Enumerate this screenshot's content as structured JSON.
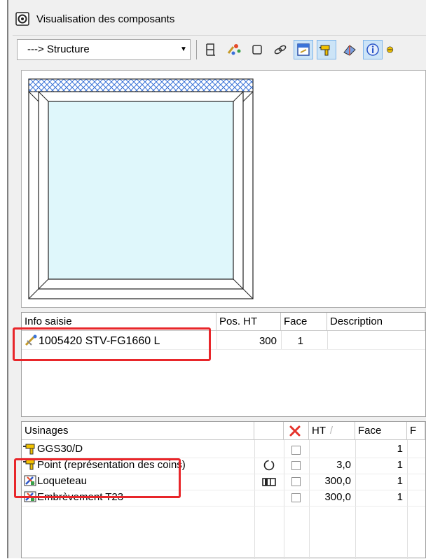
{
  "window": {
    "title": "Visualisation des composants"
  },
  "toolbar": {
    "view_select": "---> Structure"
  },
  "info_grid": {
    "columns": [
      "Info saisie",
      "Pos. HT",
      "Face",
      "Description"
    ],
    "rows": [
      {
        "info": "1005420 STV-FG1660 L",
        "pos_ht": "300",
        "face": "1",
        "description": ""
      }
    ]
  },
  "usinages_grid": {
    "columns": [
      "Usinages",
      "HT",
      "Face",
      "F"
    ],
    "sort_indicator": "/",
    "rows": [
      {
        "name": "GGS30/D",
        "ht": "",
        "face": "1"
      },
      {
        "name": "Point (représentation des coins)",
        "ht": "3,0",
        "face": "1"
      },
      {
        "name": "Loqueteau",
        "ht": "300,0",
        "face": "1"
      },
      {
        "name": "Embrèvement T23",
        "ht": "300,0",
        "face": "1"
      }
    ]
  },
  "colors": {
    "highlight": "#e8262a",
    "glass": "#dff7fb",
    "hatch": "#3a73d8"
  }
}
